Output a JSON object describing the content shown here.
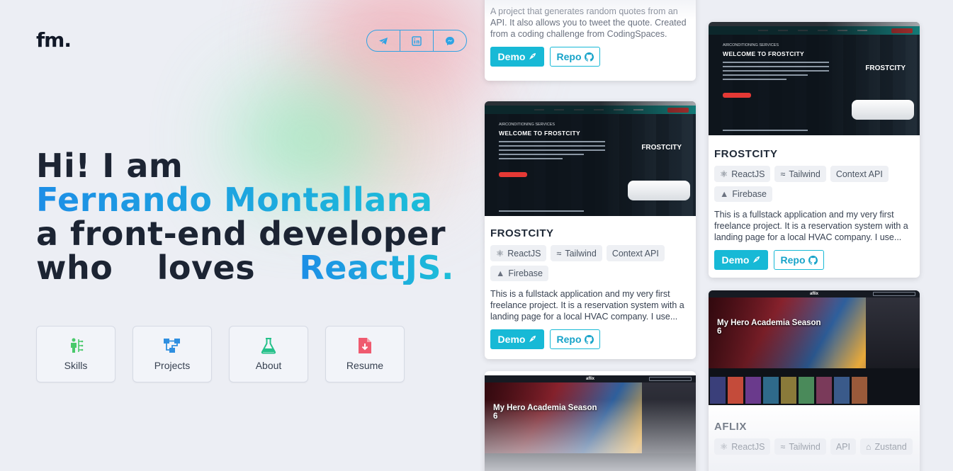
{
  "brand": {
    "logo": "fm."
  },
  "social": {
    "items": [
      {
        "icon": "telegram-icon"
      },
      {
        "icon": "linkedin-icon"
      },
      {
        "icon": "messenger-icon"
      }
    ],
    "accent": "#2fa3e4"
  },
  "hero": {
    "line1": "Hi! I am",
    "name": "Fernando Montallana",
    "line3": "a front-end developer",
    "line4_w1": "who",
    "line4_w2": "loves",
    "line4_w3": "ReactJS."
  },
  "nav": {
    "items": [
      {
        "label": "Skills",
        "icon": "skills-icon",
        "color": "#49c96b"
      },
      {
        "label": "Projects",
        "icon": "projects-icon",
        "color": "#2f8fe0"
      },
      {
        "label": "About",
        "icon": "flask-icon",
        "color": "#25c18a"
      },
      {
        "label": "Resume",
        "icon": "resume-icon",
        "color": "#ef5a6f"
      }
    ]
  },
  "projects": {
    "quotes_card": {
      "desc": "A project that generates random quotes from an API. It also allows you to tweet the quote. Created from a coding challenge from CodingSpaces.",
      "demo": "Demo",
      "repo": "Repo"
    },
    "frostcity_left": {
      "title": "FROSTCITY",
      "tags": [
        "ReactJS",
        "Tailwind",
        "Context API",
        "Firebase"
      ],
      "desc": "This is a fullstack application and my very first freelance project. It is a reservation system with a landing page for a local HVAC company. I use...",
      "demo": "Demo",
      "repo": "Repo",
      "shot": {
        "kicker": "AIRCONDITIONING SERVICES",
        "title": "WELCOME TO FROSTCITY",
        "brand": "FROSTCITY"
      }
    },
    "frostcity_right": {
      "title": "FROSTCITY",
      "tags": [
        "ReactJS",
        "Tailwind",
        "Context API",
        "Firebase"
      ],
      "desc": "This is a fullstack application and my very first freelance project. It is a reservation system with a landing page for a local HVAC company. I use...",
      "demo": "Demo",
      "repo": "Repo",
      "shot": {
        "kicker": "AIRCONDITIONING SERVICES",
        "title": "WELCOME TO FROSTCITY",
        "brand": "FROSTCITY"
      }
    },
    "aflix_left": {
      "shot": {
        "logo": "aflix",
        "banner": "My Hero Academia Season 6"
      }
    },
    "aflix_right": {
      "title": "AFLIX",
      "tags": [
        "ReactJS",
        "Tailwind",
        "API",
        "Zustand"
      ],
      "shot": {
        "logo": "aflix",
        "banner": "My Hero Academia Season 6"
      }
    }
  },
  "colors": {
    "accent_cyan": "#17b9d6",
    "gradient_start": "#1d8ee6",
    "gradient_end": "#1dbfd8",
    "text_dark": "#1c2433"
  }
}
